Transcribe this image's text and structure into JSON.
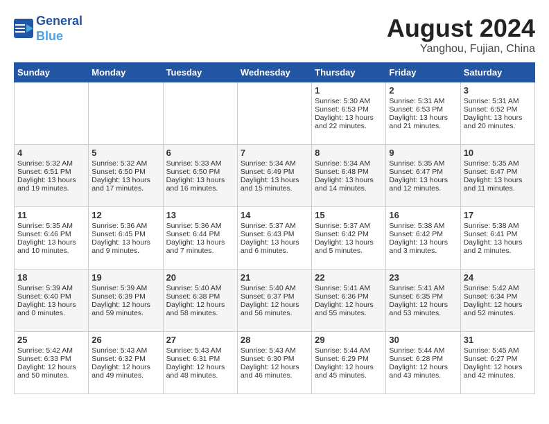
{
  "header": {
    "logo_line1": "General",
    "logo_line2": "Blue",
    "month_year": "August 2024",
    "location": "Yanghou, Fujian, China"
  },
  "days_of_week": [
    "Sunday",
    "Monday",
    "Tuesday",
    "Wednesday",
    "Thursday",
    "Friday",
    "Saturday"
  ],
  "weeks": [
    [
      {
        "day": "",
        "info": ""
      },
      {
        "day": "",
        "info": ""
      },
      {
        "day": "",
        "info": ""
      },
      {
        "day": "",
        "info": ""
      },
      {
        "day": "1",
        "info": "Sunrise: 5:30 AM\nSunset: 6:53 PM\nDaylight: 13 hours\nand 22 minutes."
      },
      {
        "day": "2",
        "info": "Sunrise: 5:31 AM\nSunset: 6:53 PM\nDaylight: 13 hours\nand 21 minutes."
      },
      {
        "day": "3",
        "info": "Sunrise: 5:31 AM\nSunset: 6:52 PM\nDaylight: 13 hours\nand 20 minutes."
      }
    ],
    [
      {
        "day": "4",
        "info": "Sunrise: 5:32 AM\nSunset: 6:51 PM\nDaylight: 13 hours\nand 19 minutes."
      },
      {
        "day": "5",
        "info": "Sunrise: 5:32 AM\nSunset: 6:50 PM\nDaylight: 13 hours\nand 17 minutes."
      },
      {
        "day": "6",
        "info": "Sunrise: 5:33 AM\nSunset: 6:50 PM\nDaylight: 13 hours\nand 16 minutes."
      },
      {
        "day": "7",
        "info": "Sunrise: 5:34 AM\nSunset: 6:49 PM\nDaylight: 13 hours\nand 15 minutes."
      },
      {
        "day": "8",
        "info": "Sunrise: 5:34 AM\nSunset: 6:48 PM\nDaylight: 13 hours\nand 14 minutes."
      },
      {
        "day": "9",
        "info": "Sunrise: 5:35 AM\nSunset: 6:47 PM\nDaylight: 13 hours\nand 12 minutes."
      },
      {
        "day": "10",
        "info": "Sunrise: 5:35 AM\nSunset: 6:47 PM\nDaylight: 13 hours\nand 11 minutes."
      }
    ],
    [
      {
        "day": "11",
        "info": "Sunrise: 5:35 AM\nSunset: 6:46 PM\nDaylight: 13 hours\nand 10 minutes."
      },
      {
        "day": "12",
        "info": "Sunrise: 5:36 AM\nSunset: 6:45 PM\nDaylight: 13 hours\nand 9 minutes."
      },
      {
        "day": "13",
        "info": "Sunrise: 5:36 AM\nSunset: 6:44 PM\nDaylight: 13 hours\nand 7 minutes."
      },
      {
        "day": "14",
        "info": "Sunrise: 5:37 AM\nSunset: 6:43 PM\nDaylight: 13 hours\nand 6 minutes."
      },
      {
        "day": "15",
        "info": "Sunrise: 5:37 AM\nSunset: 6:42 PM\nDaylight: 13 hours\nand 5 minutes."
      },
      {
        "day": "16",
        "info": "Sunrise: 5:38 AM\nSunset: 6:42 PM\nDaylight: 13 hours\nand 3 minutes."
      },
      {
        "day": "17",
        "info": "Sunrise: 5:38 AM\nSunset: 6:41 PM\nDaylight: 13 hours\nand 2 minutes."
      }
    ],
    [
      {
        "day": "18",
        "info": "Sunrise: 5:39 AM\nSunset: 6:40 PM\nDaylight: 13 hours\nand 0 minutes."
      },
      {
        "day": "19",
        "info": "Sunrise: 5:39 AM\nSunset: 6:39 PM\nDaylight: 12 hours\nand 59 minutes."
      },
      {
        "day": "20",
        "info": "Sunrise: 5:40 AM\nSunset: 6:38 PM\nDaylight: 12 hours\nand 58 minutes."
      },
      {
        "day": "21",
        "info": "Sunrise: 5:40 AM\nSunset: 6:37 PM\nDaylight: 12 hours\nand 56 minutes."
      },
      {
        "day": "22",
        "info": "Sunrise: 5:41 AM\nSunset: 6:36 PM\nDaylight: 12 hours\nand 55 minutes."
      },
      {
        "day": "23",
        "info": "Sunrise: 5:41 AM\nSunset: 6:35 PM\nDaylight: 12 hours\nand 53 minutes."
      },
      {
        "day": "24",
        "info": "Sunrise: 5:42 AM\nSunset: 6:34 PM\nDaylight: 12 hours\nand 52 minutes."
      }
    ],
    [
      {
        "day": "25",
        "info": "Sunrise: 5:42 AM\nSunset: 6:33 PM\nDaylight: 12 hours\nand 50 minutes."
      },
      {
        "day": "26",
        "info": "Sunrise: 5:43 AM\nSunset: 6:32 PM\nDaylight: 12 hours\nand 49 minutes."
      },
      {
        "day": "27",
        "info": "Sunrise: 5:43 AM\nSunset: 6:31 PM\nDaylight: 12 hours\nand 48 minutes."
      },
      {
        "day": "28",
        "info": "Sunrise: 5:43 AM\nSunset: 6:30 PM\nDaylight: 12 hours\nand 46 minutes."
      },
      {
        "day": "29",
        "info": "Sunrise: 5:44 AM\nSunset: 6:29 PM\nDaylight: 12 hours\nand 45 minutes."
      },
      {
        "day": "30",
        "info": "Sunrise: 5:44 AM\nSunset: 6:28 PM\nDaylight: 12 hours\nand 43 minutes."
      },
      {
        "day": "31",
        "info": "Sunrise: 5:45 AM\nSunset: 6:27 PM\nDaylight: 12 hours\nand 42 minutes."
      }
    ]
  ]
}
